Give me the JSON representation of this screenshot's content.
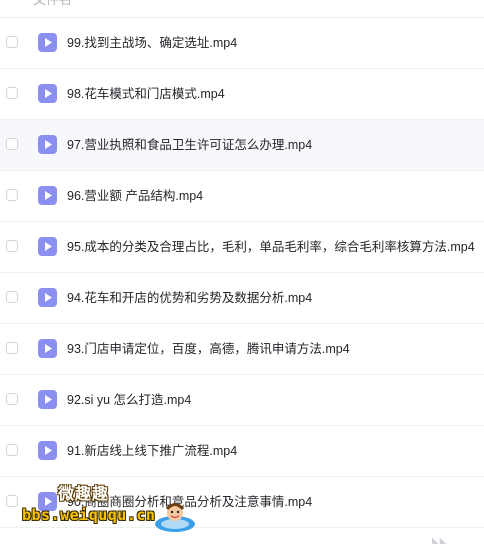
{
  "header": {
    "column_label": "文件名"
  },
  "files": [
    {
      "name": "99.找到主战场、确定选址.mp4"
    },
    {
      "name": "98.花车模式和门店模式.mp4"
    },
    {
      "name": "97.营业执照和食品卫生许可证怎么办理.mp4"
    },
    {
      "name": "96.营业额 产品结构.mp4"
    },
    {
      "name": "95.成本的分类及合理占比，毛利，单品毛利率，综合毛利率核算方法.mp4"
    },
    {
      "name": "94.花车和开店的优势和劣势及数据分析.mp4"
    },
    {
      "name": "93.门店申请定位，百度，高德，腾讯申请方法.mp4"
    },
    {
      "name": "92.si yu 怎么打造.mp4"
    },
    {
      "name": "91.新店线上线下推广流程.mp4"
    },
    {
      "name": "90.商圈商圈分析和竞品分析及注意事情.mp4"
    }
  ],
  "icons": {
    "file": "video-file-icon",
    "checkbox": "checkbox-unchecked"
  },
  "colors": {
    "icon_bg": "#8b8ff0",
    "hover_row": "#f7f8fb"
  },
  "watermark": {
    "title": "微趣趣",
    "url": "bbs.weiququ.cn"
  }
}
